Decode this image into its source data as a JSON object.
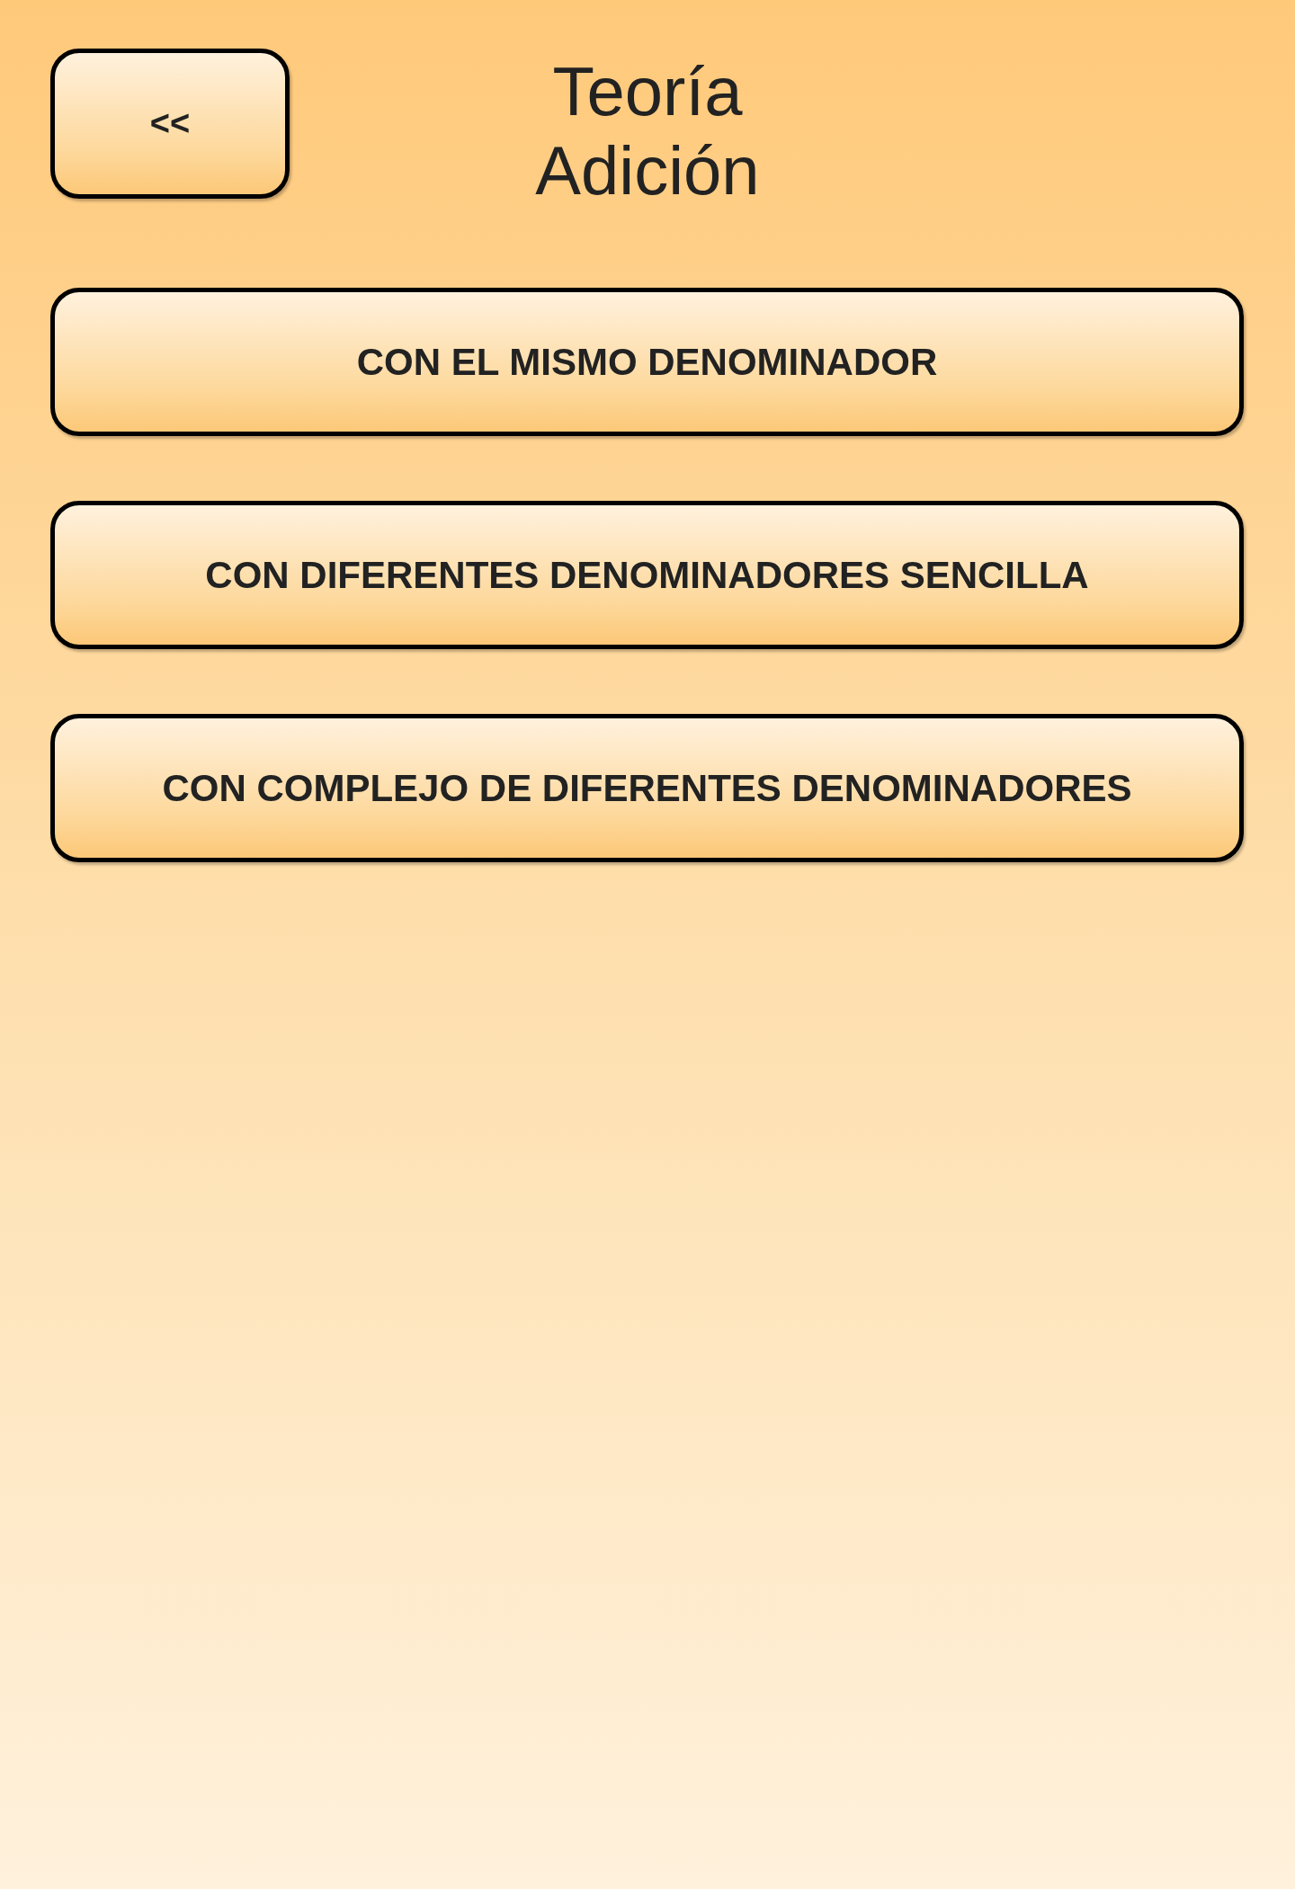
{
  "back_button": {
    "label": "<<"
  },
  "title": "Teoría\nAdición",
  "options": [
    {
      "label": "CON EL MISMO DENOMINADOR"
    },
    {
      "label": "CON DIFERENTES DENOMINADORES SENCILLA"
    },
    {
      "label": "CON COMPLEJO DE DIFERENTES DENOMINADORES"
    }
  ]
}
